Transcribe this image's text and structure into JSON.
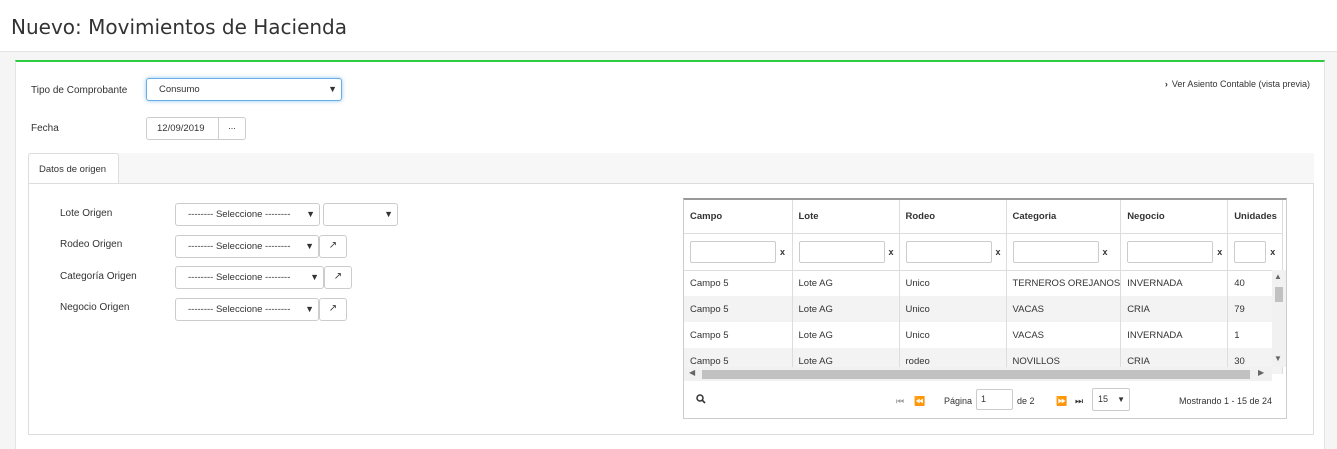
{
  "page": {
    "title": "Nuevo: Movimientos de Hacienda"
  },
  "form": {
    "tipo_label": "Tipo de Comprobante",
    "tipo_value": "Consumo",
    "fecha_label": "Fecha",
    "fecha_value": "12/09/2019",
    "fecha_button": "...",
    "preview_icon": "chevron-right-icon",
    "preview_link": "Ver Asiento Contable (vista previa)"
  },
  "tabs": [
    {
      "label": "Datos de origen"
    }
  ],
  "origen": {
    "lote_label": "Lote Origen",
    "rodeo_label": "Rodeo Origen",
    "categoria_label": "Categoría Origen",
    "negocio_label": "Negocio Origen",
    "select_placeholder": "-------- Seleccione --------",
    "external_icon": "external-link-icon"
  },
  "grid": {
    "columns": [
      "Campo",
      "Lote",
      "Rodeo",
      "Categoria",
      "Negocio",
      "Unidades"
    ],
    "filter_clear": "x",
    "rows": [
      [
        "Campo 5",
        "Lote AG",
        "Unico",
        "TERNEROS OREJANOS",
        "INVERNADA",
        "40"
      ],
      [
        "Campo 5",
        "Lote AG",
        "Unico",
        "VACAS",
        "CRIA",
        "79"
      ],
      [
        "Campo 5",
        "Lote AG",
        "Unico",
        "VACAS",
        "INVERNADA",
        "1"
      ],
      [
        "Campo 5",
        "Lote AG",
        "rodeo",
        "NOVILLOS",
        "CRIA",
        "30"
      ]
    ],
    "pager": {
      "search_icon": "search-icon",
      "page_label": "Página",
      "page_value": "1",
      "of_label": "de 2",
      "page_size": "15",
      "showing": "Mostrando 1 - 15 de 24"
    }
  },
  "colors": {
    "accent": "#2ecc40",
    "focus": "#66afe9"
  }
}
